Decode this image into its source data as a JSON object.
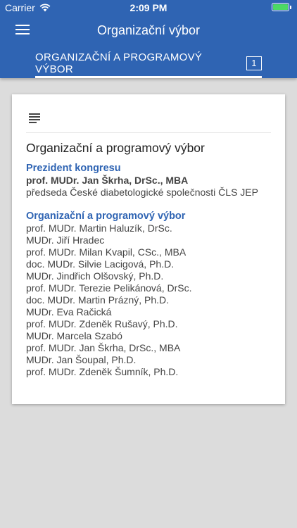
{
  "status_bar": {
    "carrier": "Carrier",
    "time": "2:09 PM",
    "battery_color": "#4cd964"
  },
  "app_bar": {
    "title": "Organizační výbor",
    "menu_icon": "hamburger-menu-icon",
    "color": "#2f64b3"
  },
  "tabs": [
    {
      "label": "ORGANIZAČNÍ A PROGRAMOVÝ VÝBOR",
      "badge": "1",
      "selected": true
    }
  ],
  "card": {
    "icon": "document-lines-icon",
    "title": "Organizační a programový výbor",
    "president": {
      "heading": "Prezident kongresu",
      "name": "prof. MUDr. Jan Škrha, DrSc., MBA",
      "role": "předseda České diabetologické společnosti ČLS JEP"
    },
    "committee": {
      "heading": "Organizační a programový výbor",
      "members": [
        "prof. MUDr. Martin Haluzík, DrSc.",
        "MUDr. Jiří Hradec",
        "prof. MUDr. Milan Kvapil, CSc., MBA",
        "doc. MUDr. Silvie Lacigová, Ph.D.",
        "MUDr. Jindřich Olšovský, Ph.D.",
        "prof. MUDr. Terezie Pelikánová, DrSc.",
        "doc. MUDr. Martin Prázný, Ph.D.",
        "MUDr. Eva Račická",
        "prof. MUDr. Zdeněk Rušavý, Ph.D.",
        "MUDr. Marcela Szabó",
        "prof. MUDr. Jan Škrha, DrSc., MBA",
        "MUDr. Jan Šoupal, Ph.D.",
        "prof. MUDr. Zdeněk Šumník, Ph.D."
      ]
    }
  }
}
